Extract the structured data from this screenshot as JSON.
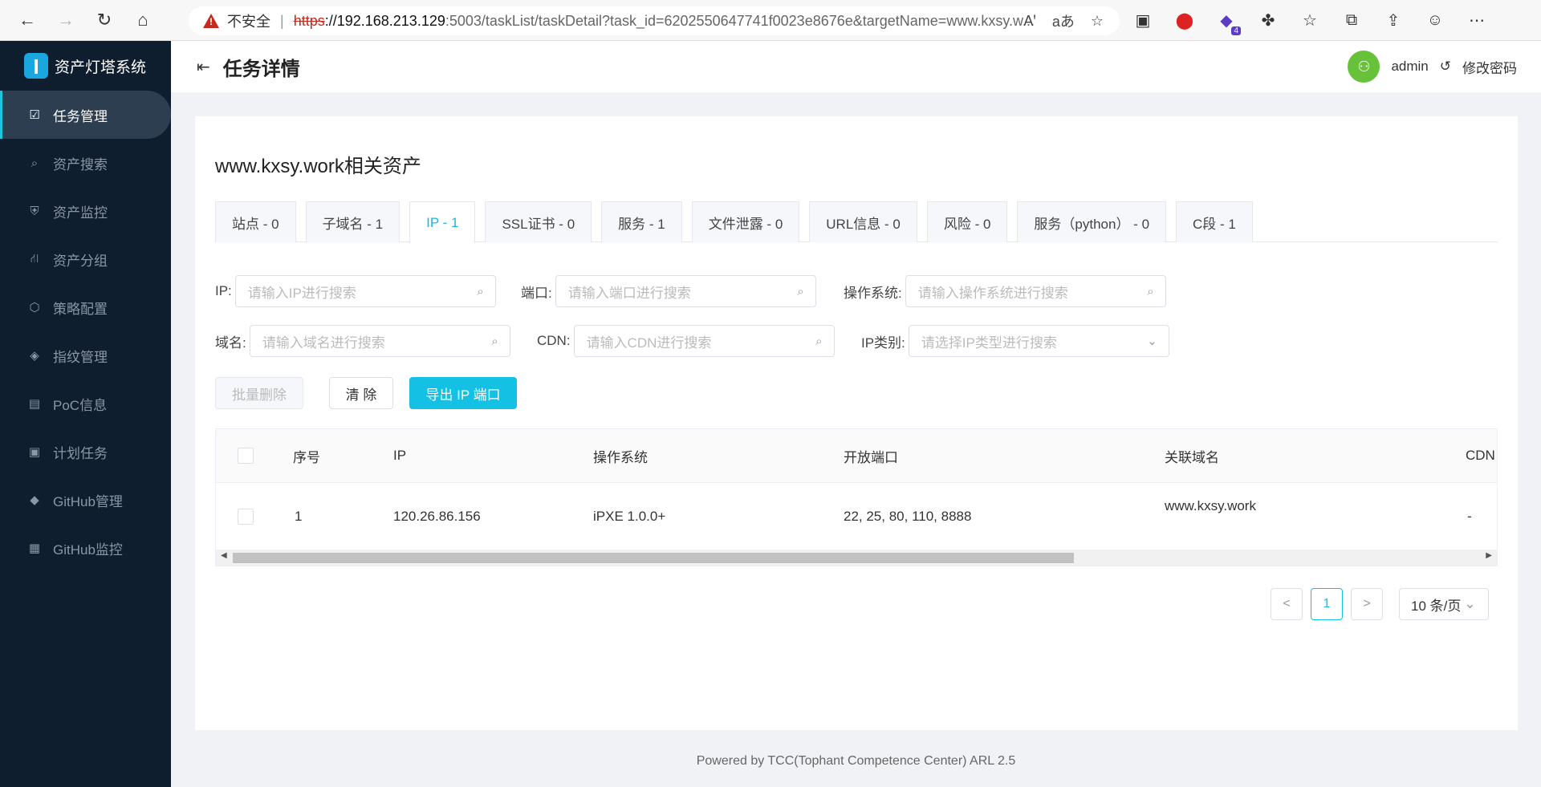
{
  "browser": {
    "insecure_label": "不安全",
    "url_scheme": "https",
    "url_host": "://192.168.213.129",
    "url_rest": ":5003/taskList/taskDetail?task_id=6202550647741f0023e8676e&targetName=www.kxsy.w...",
    "ext_badge": "4"
  },
  "sidebar": {
    "brand": "资产灯塔系统",
    "items": [
      {
        "label": "任务管理",
        "icon": "☑"
      },
      {
        "label": "资产搜索",
        "icon": "⌕"
      },
      {
        "label": "资产监控",
        "icon": "⛨"
      },
      {
        "label": "资产分组",
        "icon": "⛙"
      },
      {
        "label": "策略配置",
        "icon": "⬡"
      },
      {
        "label": "指纹管理",
        "icon": "◈"
      },
      {
        "label": "PoC信息",
        "icon": "▤"
      },
      {
        "label": "计划任务",
        "icon": "▣"
      },
      {
        "label": "GitHub管理",
        "icon": "◆"
      },
      {
        "label": "GitHub监控",
        "icon": "▦"
      }
    ]
  },
  "header": {
    "title": "任务详情",
    "username": "admin",
    "change_password": "修改密码"
  },
  "main": {
    "heading": "www.kxsy.work相关资产",
    "tabs": [
      "站点 - 0",
      "子域名 - 1",
      "IP - 1",
      "SSL证书 - 0",
      "服务 - 1",
      "文件泄露 - 0",
      "URL信息 - 0",
      "风险 - 0",
      "服务（python） - 0",
      "C段 - 1"
    ],
    "filters": {
      "ip_label": "IP:",
      "ip_placeholder": "请输入IP进行搜索",
      "port_label": "端口:",
      "port_placeholder": "请输入端口进行搜索",
      "os_label": "操作系统:",
      "os_placeholder": "请输入操作系统进行搜索",
      "domain_label": "域名:",
      "domain_placeholder": "请输入域名进行搜索",
      "cdn_label": "CDN:",
      "cdn_placeholder": "请输入CDN进行搜索",
      "iptype_label": "IP类别:",
      "iptype_placeholder": "请选择IP类型进行搜索"
    },
    "buttons": {
      "batch_delete": "批量删除",
      "clear": "清 除",
      "export": "导出 IP 端口"
    },
    "table": {
      "columns": [
        "序号",
        "IP",
        "操作系统",
        "开放端口",
        "关联域名",
        "CDN"
      ],
      "rows": [
        {
          "index": "1",
          "ip": "120.26.86.156",
          "os": "iPXE 1.0.0+",
          "ports": "22, 25, 80, 110, 8888",
          "domain": "www.kxsy.work",
          "cdn": "-"
        }
      ]
    },
    "pagination": {
      "prev": "<",
      "current": "1",
      "next": ">",
      "page_size": "10 条/页"
    }
  },
  "footer": "Powered by TCC(Tophant Competence Center) ARL 2.5"
}
